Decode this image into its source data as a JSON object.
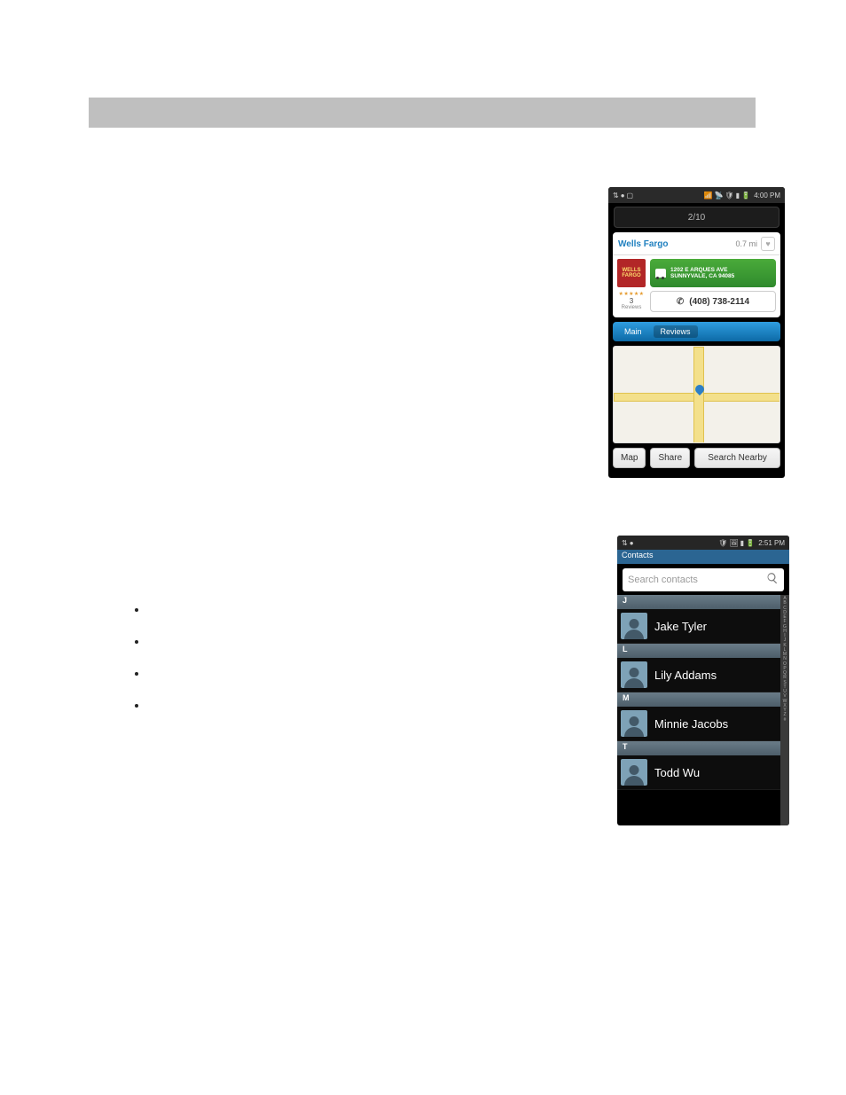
{
  "figure1": {
    "status": {
      "left": [
        "⇅",
        "●",
        "▢"
      ],
      "right": [
        "📶",
        "📡",
        "🛡",
        "📊",
        "🔋"
      ],
      "time": "4:00 PM"
    },
    "pager": "2/10",
    "business": {
      "name": "Wells Fargo",
      "distance": "0.7 mi",
      "logo": "WELLS\nFARGO"
    },
    "address": {
      "line1": "1202 E ARQUES AVE",
      "line2": "SUNNYVALE, CA 94085"
    },
    "reviews": {
      "stars": "★★★★★",
      "count": "3",
      "label": "Reviews"
    },
    "phone": "(408) 738-2114",
    "tabs": {
      "main": "Main",
      "reviews": "Reviews"
    },
    "buttons": {
      "map": "Map",
      "share": "Share",
      "search": "Search Nearby"
    }
  },
  "figure2": {
    "status": {
      "left": [
        "⇅",
        "●"
      ],
      "right": [
        "🛡",
        "🖼",
        "📊",
        "🔋"
      ],
      "time": "2:51 PM"
    },
    "title": "Contacts",
    "search_placeholder": "Search contacts",
    "sections": [
      {
        "letter": "J",
        "items": [
          "Jake Tyler"
        ]
      },
      {
        "letter": "L",
        "items": [
          "Lily Addams"
        ]
      },
      {
        "letter": "M",
        "items": [
          "Minnie Jacobs"
        ]
      },
      {
        "letter": "T",
        "items": [
          "Todd Wu"
        ]
      }
    ],
    "alpha_index": "ABCDEFGHIJKLMNOPQRSTUVWXYZ#"
  },
  "bullets": [
    "",
    "",
    "",
    ""
  ]
}
